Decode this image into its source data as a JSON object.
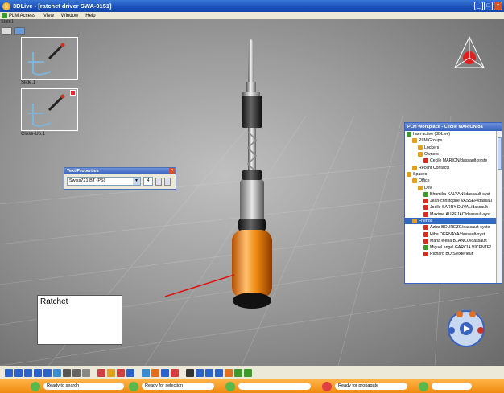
{
  "window": {
    "title": "3DLive - [ratchet driver SWA-0151]",
    "controls": {
      "minimize": "_",
      "maximize": "□",
      "close": "×"
    }
  },
  "menubar": {
    "items": [
      {
        "label": "PLM Access"
      },
      {
        "label": "View"
      },
      {
        "label": "Window"
      },
      {
        "label": "Help"
      }
    ]
  },
  "viewport": {
    "state_label": "State1",
    "thumbnails": [
      {
        "label": "Slide.1"
      },
      {
        "label": "Close-Up.1"
      }
    ],
    "note": {
      "text": "Ratchet"
    }
  },
  "text_properties": {
    "title": "Text Properties",
    "font": "Swiss721 BT (PS)",
    "size": "4"
  },
  "plm_workplace": {
    "title": "PLM Workplace - Cecile MARION/da",
    "rows": [
      {
        "label": "I am active (3DLive)",
        "icon": "status-icon",
        "color": "#3b9a2a",
        "indent": 0
      },
      {
        "label": "PLM Groups",
        "icon": "group-icon",
        "color": "#e0a020",
        "indent": 1
      },
      {
        "label": "Lockers",
        "icon": "locker-icon",
        "color": "#e0a020",
        "indent": 2
      },
      {
        "label": "Owners",
        "icon": "owner-icon",
        "color": "#e0a020",
        "indent": 2
      },
      {
        "label": "Cecile MARION/dassault-syste",
        "icon": "user-icon",
        "color": "#d03020",
        "indent": 3
      },
      {
        "label": "Recent Contacts",
        "icon": "contacts-icon",
        "color": "#e0a020",
        "indent": 1
      },
      {
        "label": "Spaces",
        "icon": "space-icon",
        "color": "#e0a020",
        "indent": 0
      },
      {
        "label": "Office",
        "icon": "office-icon",
        "color": "#e0a020",
        "indent": 1
      },
      {
        "label": "Dev",
        "icon": "dev-icon",
        "color": "#e0a020",
        "indent": 2
      },
      {
        "label": "Bhumika KALYANI/dassault-syst",
        "icon": "user-icon",
        "color": "#3b9a2a",
        "indent": 3
      },
      {
        "label": "Jean-christophe VASSEP/dassau",
        "icon": "user-icon",
        "color": "#d03020",
        "indent": 3
      },
      {
        "label": "Joelle SARRY-DUVAL/dassault-",
        "icon": "user-icon",
        "color": "#d03020",
        "indent": 3
      },
      {
        "label": "Maxime AUREJAC/dassault-syst",
        "icon": "user-icon",
        "color": "#d03020",
        "indent": 3
      },
      {
        "label": "Friends",
        "icon": "friends-icon",
        "color": "#e0a020",
        "indent": 1
      },
      {
        "label": "Aziza BOUREZG/dassault-syste",
        "icon": "user-icon",
        "color": "#d03020",
        "indent": 3
      },
      {
        "label": "Hiba DERNAYA/dassault-syst",
        "icon": "user-icon",
        "color": "#d03020",
        "indent": 3
      },
      {
        "label": "Maria elena BLANCO/dassault",
        "icon": "user-icon",
        "color": "#d03020",
        "indent": 3
      },
      {
        "label": "Miguel angel GARCIA VICENTE/",
        "icon": "user-icon",
        "color": "#3b9a2a",
        "indent": 3
      },
      {
        "label": "Richard BOIS/exterieur",
        "icon": "user-icon",
        "color": "#d03020",
        "indent": 3
      }
    ]
  },
  "toolbar": {
    "icons": [
      {
        "name": "select-icon",
        "color": "#2c63c8"
      },
      {
        "name": "pan-icon",
        "color": "#2c63c8"
      },
      {
        "name": "rotate-icon",
        "color": "#2c63c8"
      },
      {
        "name": "zoom-icon",
        "color": "#2c63c8"
      },
      {
        "name": "fit-all-icon",
        "color": "#2c63c8"
      },
      {
        "name": "views-icon",
        "color": "#3a8ad0"
      },
      {
        "name": "render-icon",
        "color": "#555555"
      },
      {
        "name": "hide-show-icon",
        "color": "#666666"
      },
      {
        "name": "snapshot-icon",
        "color": "#888888"
      },
      {
        "name": "markup-icon",
        "color": "#d04040"
      },
      {
        "name": "highlight-icon",
        "color": "#e0a020"
      },
      {
        "name": "measure-icon",
        "color": "#d04040"
      },
      {
        "name": "section-icon",
        "color": "#2c63c8"
      },
      {
        "name": "annotate-icon",
        "color": "#3a8ad0"
      },
      {
        "name": "compare-icon",
        "color": "#e07020"
      },
      {
        "name": "filter-icon",
        "color": "#2c63c8"
      },
      {
        "name": "flag-icon",
        "color": "#d04040"
      },
      {
        "name": "line-icon",
        "color": "#333333"
      },
      {
        "name": "circle-icon",
        "color": "#2c63c8"
      },
      {
        "name": "rectangle-icon",
        "color": "#2c63c8"
      },
      {
        "name": "arrow-icon",
        "color": "#2c63c8"
      },
      {
        "name": "text-icon",
        "color": "#e07020"
      },
      {
        "name": "color-icon",
        "color": "#3b9a2a"
      },
      {
        "name": "apply-icon",
        "color": "#3b9a2a"
      }
    ]
  },
  "statusbar": {
    "segments": [
      {
        "text": "Ready to search",
        "bubble_color": "#5ab84a"
      },
      {
        "text": "Ready for selection",
        "bubble_color": "#5ab84a"
      },
      {
        "text": "",
        "bubble_color": "#5ab84a"
      },
      {
        "text": "Ready for propagate",
        "bubble_color": "#e04040"
      },
      {
        "text": "",
        "bubble_color": "#5ab84a"
      }
    ]
  }
}
